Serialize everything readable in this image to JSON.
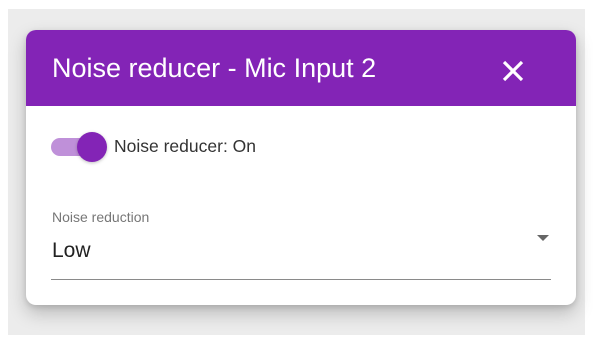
{
  "dialog": {
    "title": "Noise reducer - Mic Input 2",
    "close_icon": "close-icon"
  },
  "noise_reducer_toggle": {
    "label": "Noise reducer: On",
    "checked": true
  },
  "noise_reduction_select": {
    "label": "Noise reduction",
    "value": "Low",
    "icon": "arrow-drop-down-icon"
  },
  "colors": {
    "accent": "#8324b6",
    "toggle_track": "#bf90d9",
    "backdrop": "#ececec"
  }
}
